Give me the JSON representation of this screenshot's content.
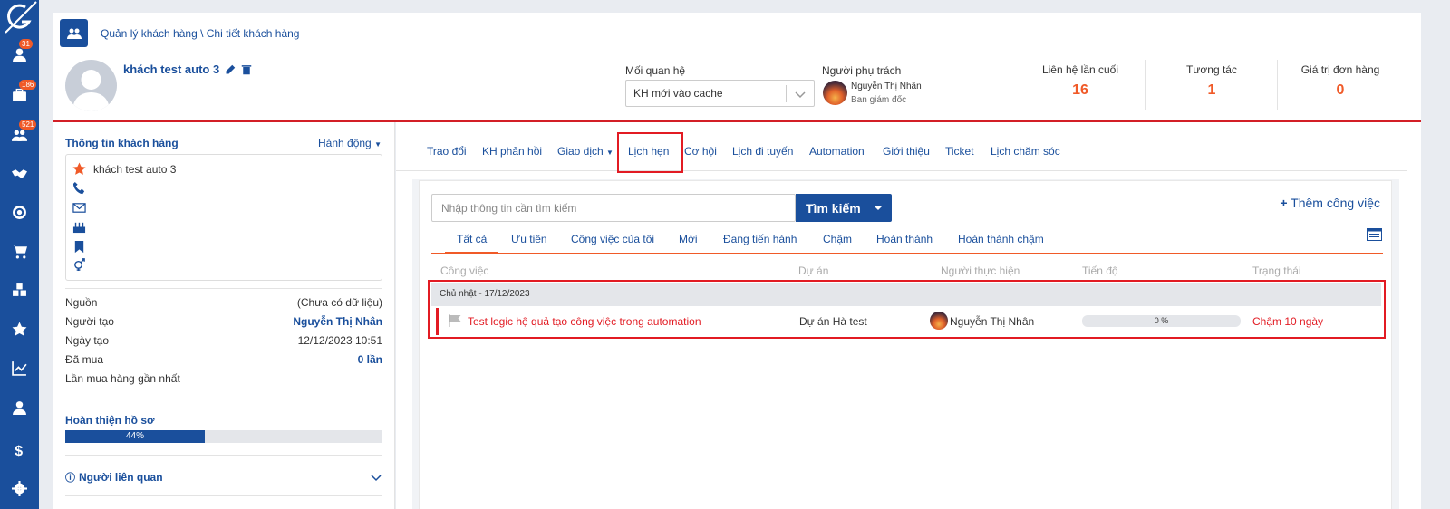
{
  "nav": {
    "badges": {
      "customers": "31",
      "inbox": "186",
      "groups": "521"
    }
  },
  "header": {
    "breadcrumb": "Quản lý khách hàng \\ Chi tiết khách hàng",
    "customer_name": "khách test auto 3",
    "relationship_label": "Mối quan hệ",
    "relationship_value": "KH mới vào cache",
    "owner_label": "Người phụ trách",
    "owner_name": "Nguyễn Thị Nhân",
    "owner_role": "Ban giám đốc",
    "stats": [
      {
        "label": "Liên hệ lần cuối",
        "value": "16"
      },
      {
        "label": "Tương tác",
        "value": "1"
      },
      {
        "label": "Giá trị đơn hàng",
        "value": "0"
      }
    ]
  },
  "left": {
    "title": "Thông tin khách hàng",
    "action": "Hành động",
    "info_name": "khách test auto 3",
    "fields": [
      {
        "label": "Nguồn",
        "value": "(Chưa có dữ liệu)"
      },
      {
        "label": "Người tạo",
        "value": "Nguyễn Thị Nhân"
      },
      {
        "label": "Ngày tạo",
        "value": "12/12/2023 10:51"
      },
      {
        "label": "Đã mua",
        "value": "0 lần"
      },
      {
        "label": "Lần mua hàng gần nhất",
        "value": ""
      }
    ],
    "profile_title": "Hoàn thiện hồ sơ",
    "profile_percent": 44,
    "profile_percent_label": "44%",
    "related_title": "Người liên quan"
  },
  "tabs": [
    "Trao đổi",
    "KH phản hồi",
    "Giao dịch",
    "Lịch hẹn",
    "Cơ hội",
    "Lịch đi tuyến",
    "Automation",
    "Giới thiệu",
    "Ticket",
    "Lịch chăm sóc"
  ],
  "tasks": {
    "search_placeholder": "Nhập thông tin cần tìm kiếm",
    "search_button": "Tìm kiếm",
    "add_task": "Thêm công việc",
    "filters": [
      "Tất cả",
      "Ưu tiên",
      "Công việc của tôi",
      "Mới",
      "Đang tiến hành",
      "Chậm",
      "Hoàn thành",
      "Hoàn thành chậm"
    ],
    "columns": [
      "Công việc",
      "Dự án",
      "Người thực hiện",
      "Tiến độ",
      "Trạng thái"
    ],
    "group_label": "Chủ nhật - 17/12/2023",
    "row": {
      "title": "Test logic hệ quả tạo công việc trong automation",
      "project": "Dự án Hà test",
      "assignee": "Nguyễn Thị Nhân",
      "progress": "0 %",
      "status": "Chậm 10 ngày"
    }
  },
  "colors": {
    "brand": "#1a4f9c",
    "accent": "#f05a28",
    "alert": "#e21b23"
  }
}
